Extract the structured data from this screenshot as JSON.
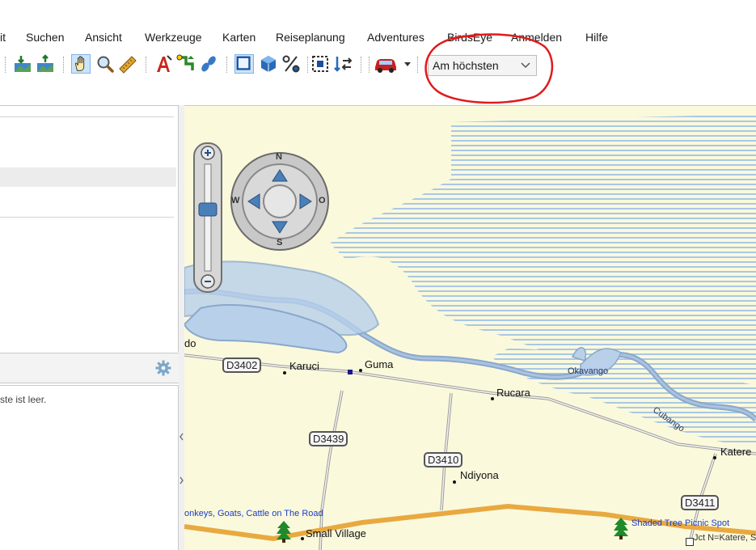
{
  "menu": {
    "items": [
      {
        "label": "it"
      },
      {
        "label": "Suchen"
      },
      {
        "label": "Ansicht"
      },
      {
        "label": "Werkzeuge"
      },
      {
        "label": "Karten"
      },
      {
        "label": "Reiseplanung"
      },
      {
        "label": "Adventures"
      },
      {
        "label": "BirdsEye"
      },
      {
        "label": "Anmelden"
      },
      {
        "label": "Hilfe"
      }
    ]
  },
  "toolbar": {
    "detail_select": {
      "value": "Am höchsten"
    },
    "icons": [
      "map-send-icon",
      "map-receive-icon",
      "hand-pan-icon",
      "zoom-icon",
      "measure-ruler-icon",
      "text-tool-icon",
      "route-tool-icon",
      "track-tool-icon",
      "map-frame-icon",
      "3d-cube-icon",
      "percent-icon",
      "select-area-icon",
      "swap-icon",
      "car-profile-icon",
      "dropdown-arrow-icon"
    ]
  },
  "left_panel": {
    "bottom_empty_text": "ste ist leer.",
    "settings_icon": "gear-icon"
  },
  "map": {
    "compass": {
      "n": "N",
      "s": "S",
      "w": "W",
      "e": "O"
    },
    "roads": [
      {
        "label": "D3402"
      },
      {
        "label": "D3439"
      },
      {
        "label": "D3410"
      },
      {
        "label": "D3411"
      }
    ],
    "places": {
      "karuci": "Karuci",
      "guma": "Guma",
      "rucara": "Rucara",
      "ndiyona": "Ndiyona",
      "katere": "Katere",
      "small_village": "Small Village",
      "do": "do"
    },
    "water": {
      "okavango": "Okavango",
      "cubango": "Cubango"
    },
    "pois": {
      "donkeys": "onkeys, Goats, Cattle on The Road",
      "shaded_tree": "Shaded Tree Picnic Spot",
      "jct": "Jct N=Katere, S"
    }
  }
}
